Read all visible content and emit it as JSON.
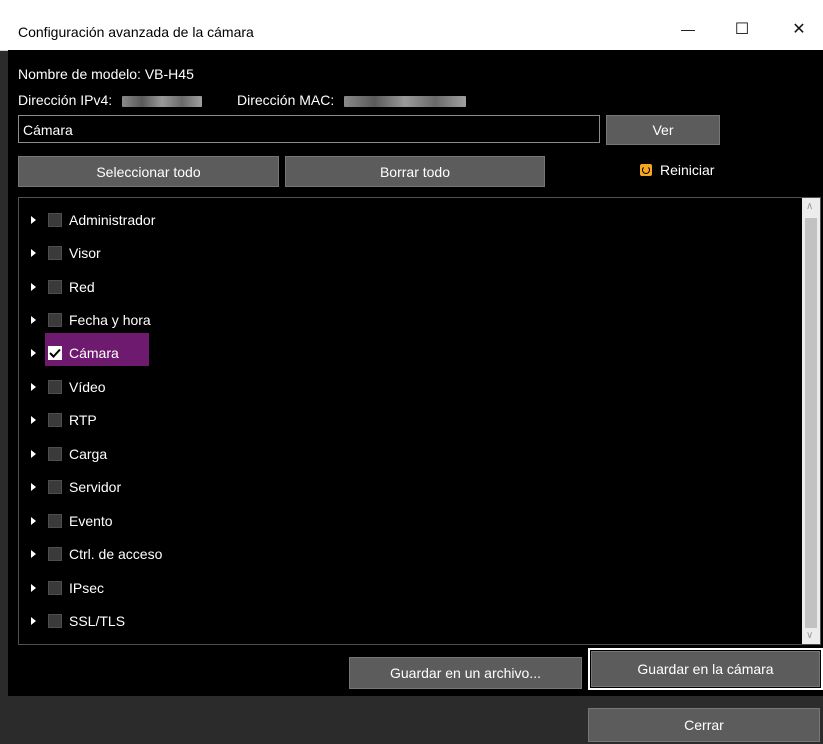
{
  "window": {
    "title": "Configuración avanzada de la cámara",
    "controls": {
      "minimize": "—",
      "maximize": "☐",
      "close": "✕"
    }
  },
  "info": {
    "model_label": "Nombre de modelo:",
    "model_value": "VB-H45",
    "ipv4_label": "Dirección IPv4:",
    "mac_label": "Dirección MAC:"
  },
  "filter": {
    "value": "Cámara",
    "view_button": "Ver"
  },
  "actions": {
    "select_all": "Seleccionar todo",
    "clear_all": "Borrar todo",
    "restart": "Reiniciar"
  },
  "tree": {
    "items": [
      {
        "label": "Administrador",
        "checked": false
      },
      {
        "label": "Visor",
        "checked": false
      },
      {
        "label": "Red",
        "checked": false
      },
      {
        "label": "Fecha y hora",
        "checked": false
      },
      {
        "label": "Cámara",
        "checked": true
      },
      {
        "label": "Vídeo",
        "checked": false
      },
      {
        "label": "RTP",
        "checked": false
      },
      {
        "label": "Carga",
        "checked": false
      },
      {
        "label": "Servidor",
        "checked": false
      },
      {
        "label": "Evento",
        "checked": false
      },
      {
        "label": "Ctrl. de acceso",
        "checked": false
      },
      {
        "label": "IPsec",
        "checked": false
      },
      {
        "label": "SSL/TLS",
        "checked": false
      }
    ],
    "selected_index": 4
  },
  "bottom": {
    "save_file": "Guardar en un archivo...",
    "save_camera": "Guardar en la cámara",
    "close": "Cerrar"
  },
  "colors": {
    "background": "#000000",
    "selection": "#6e1a6e",
    "button": "#5c5c5c",
    "restart_icon": "#f5a623"
  }
}
